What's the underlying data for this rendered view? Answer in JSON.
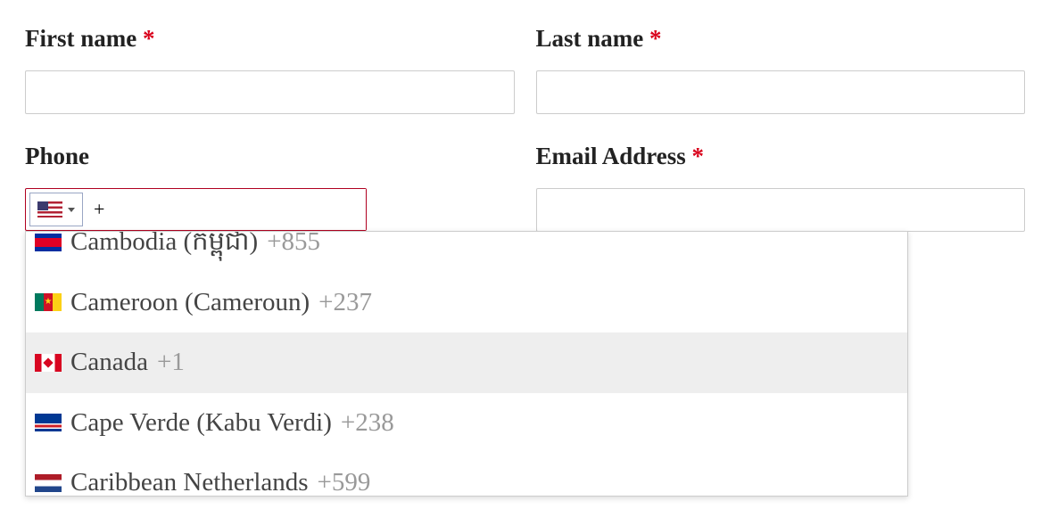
{
  "labels": {
    "first_name": "First name",
    "last_name": "Last name",
    "phone": "Phone",
    "email": "Email Address",
    "required_marker": "*"
  },
  "values": {
    "first_name": "",
    "last_name": "",
    "phone": "+",
    "email": ""
  },
  "phone_selected_country": "us",
  "dropdown": {
    "highlighted_index": 2,
    "items": [
      {
        "flag": "kh",
        "name": "Cambodia (កម្ពុជា)",
        "code": "+855"
      },
      {
        "flag": "cm",
        "name": "Cameroon (Cameroun)",
        "code": "+237"
      },
      {
        "flag": "ca",
        "name": "Canada",
        "code": "+1"
      },
      {
        "flag": "cv",
        "name": "Cape Verde (Kabu Verdi)",
        "code": "+238"
      },
      {
        "flag": "bq",
        "name": "Caribbean Netherlands",
        "code": "+599"
      }
    ]
  }
}
